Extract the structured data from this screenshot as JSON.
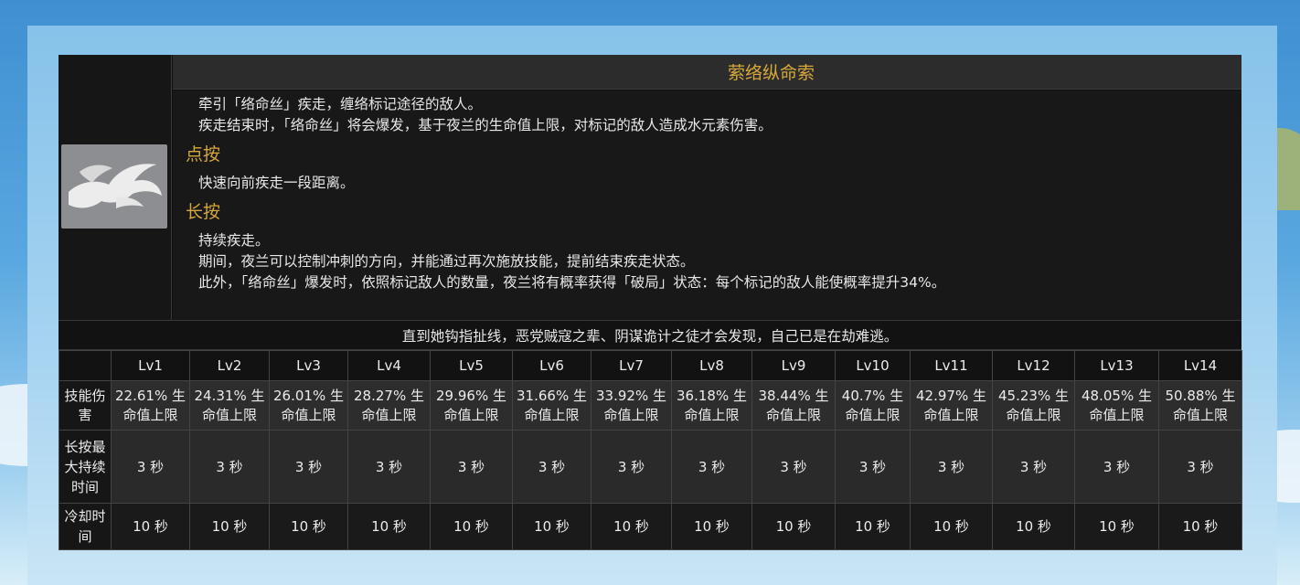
{
  "skill": {
    "name": "萦络纵命索",
    "description_lines": [
      "牵引「络命丝」疾走，缠络标记途径的敌人。",
      "疾走结束时，「络命丝」将会爆发，基于夜兰的生命值上限，对标记的敌人造成水元素伤害。"
    ],
    "tap": {
      "heading": "点按",
      "lines": [
        "快速向前疾走一段距离。"
      ]
    },
    "hold": {
      "heading": "长按",
      "lines": [
        "持续疾走。",
        "期间，夜兰可以控制冲刺的方向，并能通过再次施放技能，提前结束疾走状态。",
        "此外，「络命丝」爆发时，依照标记敌人的数量，夜兰将有概率获得「破局」状态：每个标记的敌人能使概率提升34%。"
      ]
    },
    "quote": "直到她钩指扯线，恶党贼寇之辈、阴谋诡计之徒才会发现，自己已是在劫难逃。",
    "icon": "wind-dash-icon"
  },
  "table": {
    "levels": [
      "Lv1",
      "Lv2",
      "Lv3",
      "Lv4",
      "Lv5",
      "Lv6",
      "Lv7",
      "Lv8",
      "Lv9",
      "Lv10",
      "Lv11",
      "Lv12",
      "Lv13",
      "Lv14"
    ],
    "rows": [
      {
        "label": "技能伤害",
        "values": [
          "22.61% 生命值上限",
          "24.31% 生命值上限",
          "26.01% 生命值上限",
          "28.27% 生命值上限",
          "29.96% 生命值上限",
          "31.66% 生命值上限",
          "33.92% 生命值上限",
          "36.18% 生命值上限",
          "38.44% 生命值上限",
          "40.7% 生命值上限",
          "42.97% 生命值上限",
          "45.23% 生命值上限",
          "48.05% 生命值上限",
          "50.88% 生命值上限"
        ]
      },
      {
        "label": "长按最大持续时间",
        "values": [
          "3 秒",
          "3 秒",
          "3 秒",
          "3 秒",
          "3 秒",
          "3 秒",
          "3 秒",
          "3 秒",
          "3 秒",
          "3 秒",
          "3 秒",
          "3 秒",
          "3 秒",
          "3 秒"
        ]
      },
      {
        "label": "冷却时间",
        "values": [
          "10 秒",
          "10 秒",
          "10 秒",
          "10 秒",
          "10 秒",
          "10 秒",
          "10 秒",
          "10 秒",
          "10 秒",
          "10 秒",
          "10 秒",
          "10 秒",
          "10 秒",
          "10 秒"
        ]
      }
    ]
  },
  "colors": {
    "accent_gold": "#d6a83a",
    "card_bg": "#101010",
    "row_grey": "#2d2d2d"
  }
}
